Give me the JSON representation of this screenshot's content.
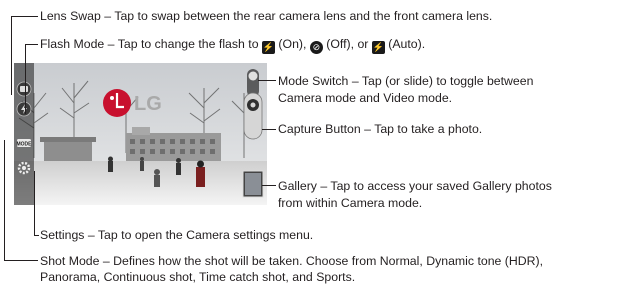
{
  "annotations": {
    "lens_swap": {
      "term": "Lens Swap",
      "desc": "Tap to swap between the rear camera lens and the front camera lens."
    },
    "flash_mode": {
      "term": "Flash Mode",
      "desc_1": "Tap to change the flash to",
      "on": "(On),",
      "off": "(Off), or",
      "auto": "(Auto)."
    },
    "mode_switch": {
      "term": "Mode Switch",
      "line_1": "Tap (or slide) to toggle between",
      "line_2": "Camera mode and Video mode."
    },
    "capture_button": {
      "term": "Capture Button",
      "desc": "Tap to take a photo."
    },
    "gallery": {
      "term": "Gallery",
      "line_1": "Tap to access your saved Gallery photos",
      "line_2": "from within Camera mode."
    },
    "settings": {
      "term": "Settings",
      "desc": "Tap to open the Camera settings menu."
    },
    "shot_mode": {
      "term": "Shot Mode",
      "line_1_a": "Defines how the shot will be taken. Choose from",
      "normal": "Normal, Dynamic tone (HDR),",
      "line_2_a": "Panorama, Continuous shot, Time catch shot,",
      "and": "and",
      "sports": "Sports."
    },
    "dash": "–"
  },
  "icons": {
    "flash_on": "flash-on-icon",
    "flash_off": "flash-off-icon",
    "flash_auto": "flash-auto-icon"
  },
  "viewfinder": {
    "logo_text": "LG",
    "mode_badge": "MODE"
  },
  "colors": {
    "lg_red": "#c8102e",
    "text": "#231f20"
  }
}
